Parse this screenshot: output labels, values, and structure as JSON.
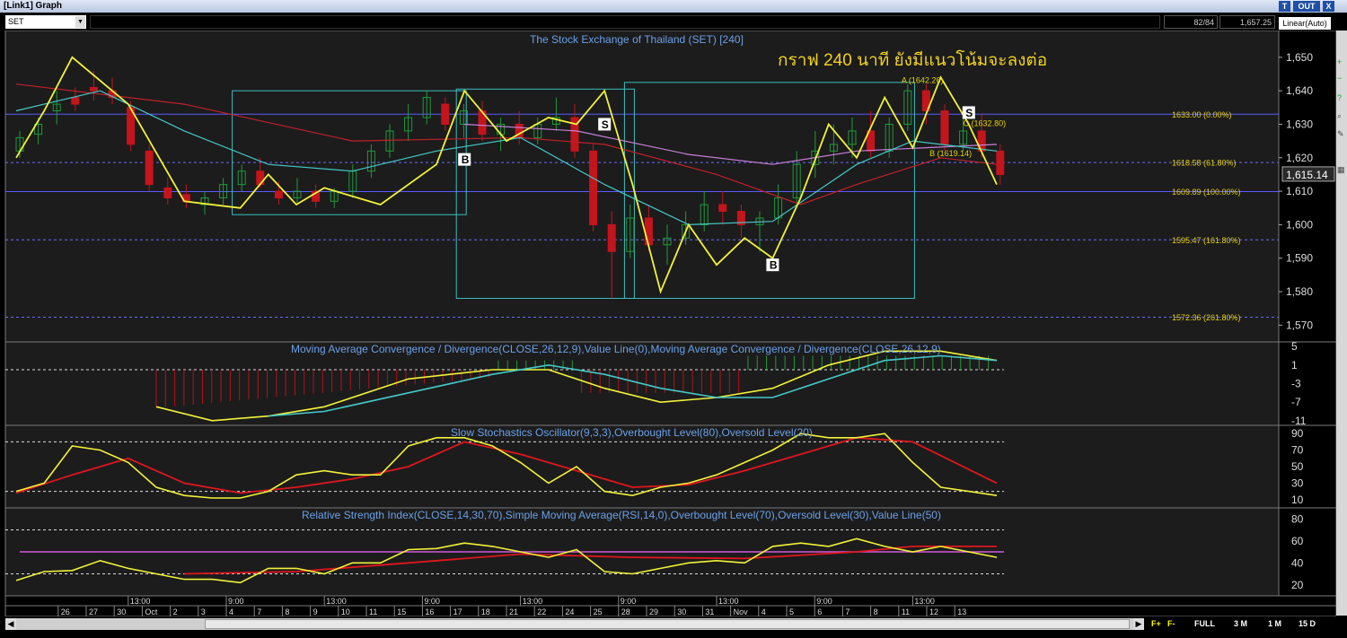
{
  "window": {
    "title": "[Link1] Graph",
    "buttons": [
      "T",
      "OUT",
      "X"
    ]
  },
  "toolbar": {
    "symbol": "SET",
    "bar_count": "82/84",
    "cursor_price": "1,657.25",
    "scale_mode": "Linear(Auto)"
  },
  "main_chart": {
    "title": "The Stock Exchange of Thailand (SET) [240]",
    "annotation": "กราฟ 240 นาที ยังมีแนวโน้มจะลงต่อ",
    "price_label": "1,615.14",
    "price_ticks": [
      "1,650",
      "1,640",
      "1,630",
      "1,620",
      "1,610",
      "1,600",
      "1,590",
      "1,580",
      "1,570"
    ],
    "fib_levels": [
      {
        "text": "1633.00 (0.00%)",
        "price": 1633.0,
        "color": "#5a5aff"
      },
      {
        "text": "1618.58 (61.80%)",
        "price": 1618.58,
        "color": "#6a6aff"
      },
      {
        "text": "1609.89 (100.00%)",
        "price": 1609.89,
        "color": "#5a5aff"
      },
      {
        "text": "1595.47 (161.80%)",
        "price": 1595.47,
        "color": "#6a6aff"
      },
      {
        "text": "1572.36 (261.80%)",
        "price": 1572.36,
        "color": "#6a6aff"
      }
    ],
    "signals": [
      {
        "text": "B",
        "bar": 16,
        "price": 1619.5
      },
      {
        "text": "S",
        "bar": 21,
        "price": 1630
      },
      {
        "text": "B",
        "bar": 27,
        "price": 1588
      },
      {
        "text": "S",
        "bar": 34,
        "price": 1633.5
      }
    ],
    "point_labels": [
      {
        "text": "A (1642.26)",
        "bar": 31.6,
        "price": 1642.3
      },
      {
        "text": "C (1632.80)",
        "bar": 33.8,
        "price": 1629.5
      },
      {
        "text": "B (1619.14)",
        "bar": 32.6,
        "price": 1620.5
      }
    ]
  },
  "x_axis": {
    "time_labels": [
      {
        "text": "13:00",
        "bar": 4
      },
      {
        "text": "9:00",
        "bar": 7.5
      },
      {
        "text": "13:00",
        "bar": 11
      },
      {
        "text": "9:00",
        "bar": 14.5
      },
      {
        "text": "13:00",
        "bar": 18
      },
      {
        "text": "9:00",
        "bar": 21.5
      },
      {
        "text": "13:00",
        "bar": 25
      },
      {
        "text": "9:00",
        "bar": 28.5
      },
      {
        "text": "13:00",
        "bar": 32
      }
    ],
    "date_labels": [
      {
        "text": "26",
        "bar": 1.5
      },
      {
        "text": "27",
        "bar": 2.5
      },
      {
        "text": "30",
        "bar": 3.5
      },
      {
        "text": "Oct",
        "bar": 4.5
      },
      {
        "text": "2",
        "bar": 5.5
      },
      {
        "text": "3",
        "bar": 6.5
      },
      {
        "text": "4",
        "bar": 7.5
      },
      {
        "text": "7",
        "bar": 8.5
      },
      {
        "text": "8",
        "bar": 9.5
      },
      {
        "text": "9",
        "bar": 10.5
      },
      {
        "text": "10",
        "bar": 11.5
      },
      {
        "text": "11",
        "bar": 12.5
      },
      {
        "text": "15",
        "bar": 13.5
      },
      {
        "text": "16",
        "bar": 14.5
      },
      {
        "text": "17",
        "bar": 15.5
      },
      {
        "text": "18",
        "bar": 16.5
      },
      {
        "text": "21",
        "bar": 17.5
      },
      {
        "text": "22",
        "bar": 18.5
      },
      {
        "text": "24",
        "bar": 19.5
      },
      {
        "text": "25",
        "bar": 20.5
      },
      {
        "text": "28",
        "bar": 21.5
      },
      {
        "text": "29",
        "bar": 22.5
      },
      {
        "text": "30",
        "bar": 23.5
      },
      {
        "text": "31",
        "bar": 24.5
      },
      {
        "text": "Nov",
        "bar": 25.5
      },
      {
        "text": "4",
        "bar": 26.5
      },
      {
        "text": "5",
        "bar": 27.5
      },
      {
        "text": "6",
        "bar": 28.5
      },
      {
        "text": "7",
        "bar": 29.5
      },
      {
        "text": "8",
        "bar": 30.5
      },
      {
        "text": "11",
        "bar": 31.5
      },
      {
        "text": "12",
        "bar": 32.5
      },
      {
        "text": "13",
        "bar": 33.5
      }
    ]
  },
  "macd_panel": {
    "title": "Moving Average Convergence / Divergence(CLOSE,26,12,9),Value Line(0),Moving Average Convergence / Divergence(CLOSE,26,12,9)",
    "ticks": [
      "5",
      "1",
      "-3",
      "-7",
      "-11"
    ]
  },
  "stoch_panel": {
    "title": "Slow Stochastics Oscillator(9,3,3),Overbought Level(80),Oversold Level(20)",
    "ticks": [
      "90",
      "70",
      "50",
      "30",
      "10"
    ]
  },
  "rsi_panel": {
    "title": "Relative Strength Index(CLOSE,14,30,70),Simple Moving Average(RSI,14,0),Overbought Level(70),Oversold Level(30),Value Line(50)",
    "ticks": [
      "80",
      "60",
      "40",
      "20"
    ]
  },
  "periods": [
    "FULL",
    "3 M",
    "1 M",
    "15 D"
  ],
  "chart_data": [
    {
      "type": "candlestick",
      "title": "The Stock Exchange of Thailand (SET) [240]",
      "ylim": [
        1565,
        1658
      ],
      "candles": [
        [
          1622,
          1628,
          1620,
          1626
        ],
        [
          1627,
          1632,
          1624,
          1630
        ],
        [
          1634,
          1640,
          1630,
          1636
        ],
        [
          1638,
          1641,
          1634,
          1636
        ],
        [
          1641,
          1646,
          1637,
          1640
        ],
        [
          1640,
          1644,
          1636,
          1638
        ],
        [
          1635,
          1637,
          1622,
          1624
        ],
        [
          1622,
          1624,
          1610,
          1612
        ],
        [
          1611,
          1614,
          1606,
          1608
        ],
        [
          1609,
          1612,
          1605,
          1607
        ],
        [
          1606,
          1610,
          1603,
          1608
        ],
        [
          1608,
          1614,
          1606,
          1612
        ],
        [
          1612,
          1618,
          1610,
          1616
        ],
        [
          1616,
          1620,
          1611,
          1612
        ],
        [
          1610,
          1613,
          1606,
          1608
        ],
        [
          1608,
          1614,
          1606,
          1610
        ],
        [
          1610,
          1612,
          1605,
          1607
        ],
        [
          1607,
          1611,
          1605,
          1610
        ],
        [
          1610,
          1618,
          1608,
          1616
        ],
        [
          1616,
          1624,
          1614,
          1622
        ],
        [
          1622,
          1630,
          1620,
          1628
        ],
        [
          1628,
          1636,
          1625,
          1632
        ],
        [
          1632,
          1640,
          1630,
          1638
        ],
        [
          1636,
          1638,
          1628,
          1630
        ],
        [
          1630,
          1636,
          1626,
          1634
        ],
        [
          1634,
          1637,
          1625,
          1627
        ],
        [
          1627,
          1632,
          1622,
          1630
        ],
        [
          1630,
          1634,
          1624,
          1626
        ],
        [
          1626,
          1632,
          1624,
          1630
        ],
        [
          1630,
          1638,
          1628,
          1632
        ],
        [
          1632,
          1636,
          1620,
          1622
        ],
        [
          1622,
          1624,
          1598,
          1600
        ],
        [
          1600,
          1604,
          1578,
          1592
        ],
        [
          1592,
          1606,
          1590,
          1602
        ],
        [
          1602,
          1606,
          1592,
          1594
        ],
        [
          1594,
          1600,
          1588,
          1596
        ],
        [
          1596,
          1604,
          1594,
          1600
        ],
        [
          1600,
          1610,
          1598,
          1606
        ],
        [
          1606,
          1610,
          1600,
          1604
        ],
        [
          1604,
          1606,
          1596,
          1600
        ],
        [
          1600,
          1604,
          1592,
          1602
        ],
        [
          1602,
          1612,
          1600,
          1608
        ],
        [
          1608,
          1622,
          1606,
          1618
        ],
        [
          1618,
          1628,
          1614,
          1622
        ],
        [
          1622,
          1630,
          1618,
          1624
        ],
        [
          1624,
          1632,
          1620,
          1628
        ],
        [
          1628,
          1634,
          1620,
          1622
        ],
        [
          1622,
          1632,
          1620,
          1630
        ],
        [
          1630,
          1642,
          1628,
          1640
        ],
        [
          1640,
          1642,
          1630,
          1634
        ],
        [
          1634,
          1636,
          1622,
          1624
        ],
        [
          1624,
          1632,
          1622,
          1628
        ],
        [
          1628,
          1633,
          1620,
          1622
        ],
        [
          1622,
          1624,
          1612,
          1615
        ]
      ],
      "zigzag": [
        [
          0,
          1620
        ],
        [
          1,
          1634
        ],
        [
          2,
          1650
        ],
        [
          4,
          1636
        ],
        [
          6,
          1607
        ],
        [
          8,
          1605
        ],
        [
          9,
          1615
        ],
        [
          10,
          1606
        ],
        [
          11,
          1611
        ],
        [
          13,
          1606
        ],
        [
          15,
          1618
        ],
        [
          16,
          1640
        ],
        [
          17.5,
          1625
        ],
        [
          19,
          1632
        ],
        [
          20,
          1630
        ],
        [
          21,
          1640
        ],
        [
          22,
          1612
        ],
        [
          23,
          1580
        ],
        [
          24,
          1600
        ],
        [
          25,
          1588
        ],
        [
          26,
          1596
        ],
        [
          27,
          1590
        ],
        [
          28,
          1608
        ],
        [
          29,
          1630
        ],
        [
          30,
          1620
        ],
        [
          31,
          1638
        ],
        [
          32,
          1623
        ],
        [
          33,
          1644
        ],
        [
          34,
          1630
        ],
        [
          35,
          1612
        ]
      ],
      "ma_red": [
        [
          0,
          1642
        ],
        [
          6,
          1636
        ],
        [
          12,
          1625
        ],
        [
          18,
          1626
        ],
        [
          21,
          1624
        ],
        [
          25,
          1615
        ],
        [
          28,
          1606
        ],
        [
          30,
          1612
        ],
        [
          33,
          1620
        ],
        [
          35,
          1618
        ]
      ],
      "ma_cyan": [
        [
          0,
          1634
        ],
        [
          3,
          1640
        ],
        [
          6,
          1628
        ],
        [
          9,
          1618
        ],
        [
          12,
          1616
        ],
        [
          15,
          1622
        ],
        [
          18,
          1626
        ],
        [
          21,
          1612
        ],
        [
          24,
          1600
        ],
        [
          27,
          1601
        ],
        [
          30,
          1618
        ],
        [
          32,
          1625
        ],
        [
          35,
          1622
        ]
      ],
      "ma_pink": [
        [
          16,
          1630
        ],
        [
          20,
          1628
        ],
        [
          24,
          1621
        ],
        [
          27,
          1618
        ],
        [
          30,
          1622
        ],
        [
          35,
          1624
        ]
      ]
    },
    {
      "type": "line",
      "title": "Moving Average Convergence / Divergence(CLOSE,26,12,9),Value Line(0),Moving Average Convergence / Divergence(CLOSE,26,12,9)",
      "ylim": [
        -12,
        6
      ],
      "series": [
        {
          "x": [
            5,
            7,
            9,
            11,
            14,
            17,
            19,
            21,
            23,
            25,
            27,
            29,
            31,
            33,
            35
          ],
          "values": [
            -8,
            -11,
            -10,
            -8,
            -2,
            0,
            0,
            -4,
            -7,
            -6,
            -4,
            1,
            4,
            4,
            2
          ]
        },
        {
          "x": [
            9,
            11,
            14,
            17,
            19,
            21,
            23,
            25,
            27,
            29,
            31,
            33,
            35
          ],
          "values": [
            -10,
            -9,
            -5,
            -1,
            1,
            -1,
            -4,
            -6,
            -6,
            -2,
            2,
            3,
            2
          ]
        }
      ]
    },
    {
      "type": "line",
      "title": "Slow Stochastics Oscillator(9,3,3),Overbought Level(80),Oversold Level(20)",
      "ylim": [
        0,
        100
      ],
      "series": [
        {
          "x": [
            0,
            1,
            2,
            3,
            4,
            5,
            6,
            7,
            8,
            9,
            10,
            11,
            12,
            13,
            14,
            15,
            16,
            17,
            18,
            19,
            20,
            21,
            22,
            23,
            24,
            25,
            26,
            27,
            28,
            29,
            30,
            31,
            32,
            33,
            34,
            35
          ],
          "values": [
            20,
            30,
            75,
            70,
            55,
            25,
            15,
            12,
            12,
            20,
            40,
            45,
            40,
            40,
            75,
            85,
            85,
            75,
            55,
            30,
            50,
            20,
            15,
            25,
            30,
            40,
            55,
            70,
            90,
            85,
            85,
            90,
            55,
            25,
            20,
            15
          ]
        },
        {
          "x": [
            0,
            2,
            4,
            6,
            8,
            10,
            12,
            14,
            16,
            18,
            20,
            22,
            24,
            26,
            28,
            30,
            32,
            35
          ],
          "values": [
            18,
            40,
            60,
            30,
            18,
            25,
            35,
            50,
            80,
            65,
            45,
            25,
            28,
            45,
            65,
            85,
            80,
            30
          ]
        }
      ]
    },
    {
      "type": "line",
      "title": "Relative Strength Index(CLOSE,14,30,70),Simple Moving Average(RSI,14,0),Overbought Level(70),Oversold Level(30),Value Line(50)",
      "ylim": [
        10,
        90
      ],
      "series": [
        {
          "x": [
            0,
            1,
            2,
            3,
            4,
            5,
            6,
            7,
            8,
            9,
            10,
            11,
            12,
            13,
            14,
            15,
            16,
            17,
            18,
            19,
            20,
            21,
            22,
            23,
            24,
            25,
            26,
            27,
            28,
            29,
            30,
            31,
            32,
            33,
            34,
            35
          ],
          "values": [
            24,
            32,
            33,
            42,
            35,
            30,
            25,
            25,
            22,
            35,
            35,
            30,
            40,
            40,
            52,
            53,
            58,
            55,
            50,
            45,
            52,
            32,
            30,
            35,
            40,
            42,
            40,
            55,
            58,
            55,
            62,
            55,
            50,
            55,
            50,
            45
          ]
        },
        {
          "x": [
            6,
            10,
            14,
            18,
            22,
            26,
            30,
            32,
            35
          ],
          "values": [
            30,
            32,
            40,
            48,
            45,
            44,
            50,
            55,
            55
          ]
        }
      ]
    }
  ]
}
